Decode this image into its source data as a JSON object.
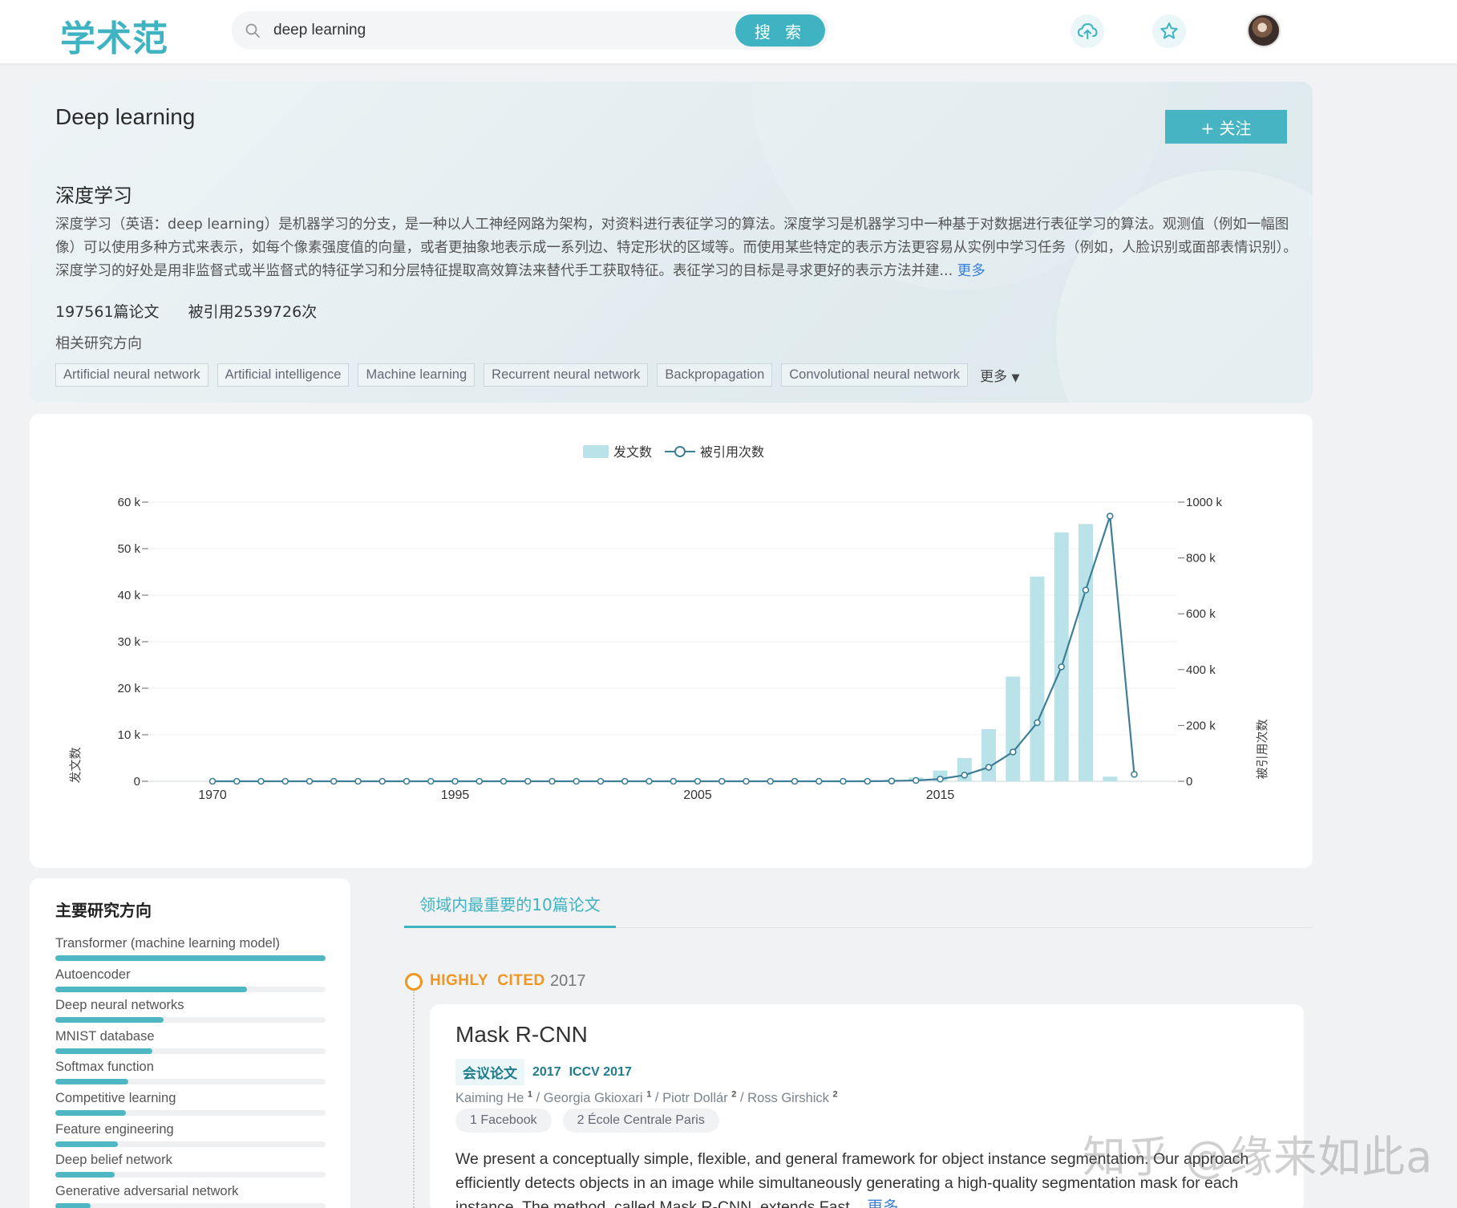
{
  "header": {
    "logo": "学术范",
    "search_value": "deep learning",
    "search_button": "搜 索",
    "icons": [
      "cloud-upload-icon",
      "star-icon"
    ],
    "avatar": "avatar"
  },
  "topic": {
    "title_en": "Deep learning",
    "follow_label": "+ 关注",
    "title_zh": "深度学习",
    "description": "深度学习（英语：deep learning）是机器学习的分支，是一种以人工神经网路为架构，对资料进行表征学习的算法。深度学习是机器学习中一种基于对数据进行表征学习的算法。观测值（例如一幅图像）可以使用多种方式来表示，如每个像素强度值的向量，或者更抽象地表示成一系列边、特定形状的区域等。而使用某些特定的表示方法更容易从实例中学习任务（例如，人脸识别或面部表情识别）。深度学习的好处是用非监督式或半监督式的特征学习和分层特征提取高效算法来替代手工获取特征。表征学习的目标是寻求更好的表示方法并建...",
    "more": "更多",
    "paper_count": "197561篇论文",
    "citation_count": "被引用2539726次",
    "related_label": "相关研究方向",
    "tags": [
      "Artificial neural network",
      "Artificial intelligence",
      "Machine learning",
      "Recurrent neural network",
      "Backpropagation",
      "Convolutional neural network"
    ],
    "tags_more": "更多"
  },
  "chart_data": {
    "type": "bar+line",
    "legend": [
      "发文数",
      "被引用次数"
    ],
    "legend_position": "top-center",
    "ylabel_left": "发文数",
    "ylabel_right": "被引用次数",
    "y_left_ticks": [
      "0",
      "10 k",
      "20 k",
      "30 k",
      "40 k",
      "50 k",
      "60 k"
    ],
    "y_right_ticks": [
      "0",
      "200 k",
      "400 k",
      "600 k",
      "800 k",
      "1000 k"
    ],
    "ylim_left": [
      0,
      60000
    ],
    "ylim_right": [
      0,
      1000000
    ],
    "x_ticks": [
      {
        "label": "1970",
        "index": 0
      },
      {
        "label": "1995",
        "index": 10
      },
      {
        "label": "2005",
        "index": 20
      },
      {
        "label": "2015",
        "index": 30
      }
    ],
    "bar_color": "#b9e3e8",
    "line_color": "#3e7f96",
    "grid": "horizontal",
    "papers": [
      20,
      10,
      10,
      10,
      10,
      10,
      10,
      10,
      10,
      10,
      20,
      20,
      20,
      20,
      30,
      30,
      30,
      40,
      40,
      50,
      60,
      70,
      80,
      90,
      110,
      130,
      160,
      220,
      350,
      800,
      2300,
      5000,
      11200,
      22500,
      44000,
      53500,
      55300,
      1000
    ],
    "citations": [
      0,
      0,
      0,
      0,
      0,
      0,
      0,
      0,
      0,
      0,
      0,
      0,
      0,
      0,
      0,
      0,
      0,
      0,
      0,
      0,
      0,
      0,
      0,
      0,
      0,
      0,
      0,
      0,
      1000,
      3000,
      8000,
      22000,
      50000,
      105000,
      210000,
      410000,
      685000,
      950000,
      25000
    ]
  },
  "left_panel": {
    "title": "主要研究方向",
    "items": [
      {
        "name": "Transformer (machine learning model)",
        "value": 1.0
      },
      {
        "name": "Autoencoder",
        "value": 0.71
      },
      {
        "name": "Deep neural networks",
        "value": 0.4
      },
      {
        "name": "MNIST database",
        "value": 0.36
      },
      {
        "name": "Softmax function",
        "value": 0.27
      },
      {
        "name": "Competitive learning",
        "value": 0.26
      },
      {
        "name": "Feature engineering",
        "value": 0.23
      },
      {
        "name": "Deep belief network",
        "value": 0.22
      },
      {
        "name": "Generative adversarial network",
        "value": 0.13
      }
    ]
  },
  "papers_section": {
    "tab": "领域内最重要的10篇论文",
    "badge": "HIGHLY  CITED",
    "badge_year": "2017",
    "paper": {
      "title": "Mask R-CNN",
      "type": "会议论文",
      "year": "2017",
      "venue": "ICCV 2017",
      "authors": [
        {
          "name": "Kaiming He",
          "aff": "1"
        },
        {
          "name": "Georgia Gkioxari",
          "aff": "1"
        },
        {
          "name": "Piotr Dollár",
          "aff": "2"
        },
        {
          "name": "Ross Girshick",
          "aff": "2"
        }
      ],
      "affiliations": [
        {
          "index": "1",
          "name": "Facebook"
        },
        {
          "index": "2",
          "name": "École Centrale Paris"
        }
      ],
      "abstract": "We present a conceptually simple, flexible, and general framework for object instance segmentation. Our approach efficiently detects objects in an image while simultaneously generating a high-quality segmentation mask for each instance. The method, called Mask R-CNN, extends Fast...",
      "more": "更多"
    }
  },
  "watermark": "知乎 @缘来如此a",
  "colors": {
    "accent": "#3fb3c1",
    "highlight": "#f0951f",
    "link": "#3b7fd9"
  }
}
